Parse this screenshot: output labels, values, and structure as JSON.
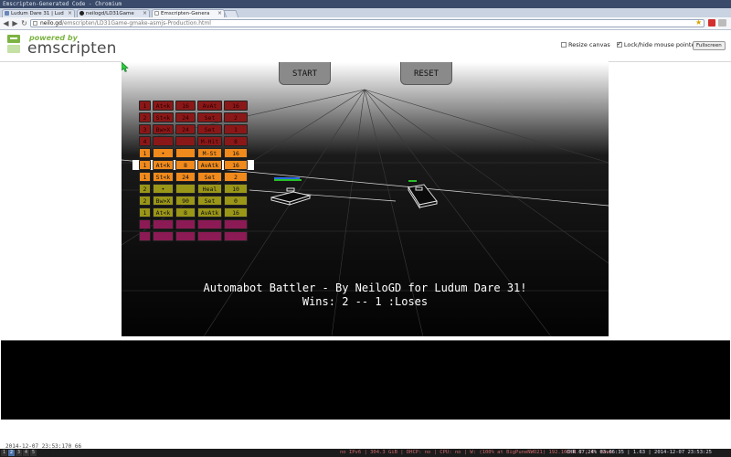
{
  "window": {
    "title": "Emscripten-Generated Code - Chromium"
  },
  "tabs": [
    {
      "label": "Ludum Dare 31 | Lud",
      "active": false
    },
    {
      "label": "neilogd/LD31Game",
      "active": false
    },
    {
      "label": "Emscripten-Genera",
      "active": true
    }
  ],
  "address": {
    "host": "neilo.gd",
    "path": "/emscripten/LD31Game-gmake-asmjs-Production.html"
  },
  "header": {
    "powered_by": "powered by",
    "brand": "emscripten",
    "resize_canvas_label": "Resize canvas",
    "resize_canvas_checked": false,
    "lock_pointer_label": "Lock/hide mouse pointer",
    "lock_pointer_checked": true,
    "fullscreen_label": "Fullscreen"
  },
  "game": {
    "start_label": "START",
    "reset_label": "RESET",
    "title_line": "Automabot Battler - By NeiloGD for Ludum Dare 31!",
    "score_line": "Wins: 2 -- 1 :Loses",
    "colors": {
      "dark_red": "#8b1818",
      "orange": "#f08a1c",
      "olive": "#9a9618",
      "magenta": "#8c1a55",
      "player_hp": "#2a6ae0",
      "green_hp": "#28c028"
    },
    "program_rows": [
      {
        "color": "dark_red",
        "cells": [
          "1",
          "At<k",
          "16",
          "AvAt",
          "16"
        ]
      },
      {
        "color": "dark_red",
        "cells": [
          "2",
          "St<k",
          "24",
          "Set",
          "2"
        ]
      },
      {
        "color": "dark_red",
        "cells": [
          "3",
          "Bw>X",
          "24",
          "Set",
          "1"
        ]
      },
      {
        "color": "dark_red",
        "cells": [
          "4",
          "",
          "",
          "M-Hit",
          "8"
        ]
      },
      {
        "color": "orange",
        "cells": [
          "1",
          "•",
          "",
          "M-St",
          "16"
        ]
      },
      {
        "color": "orange",
        "cells": [
          "1",
          "At<k",
          "8",
          "AvAtk",
          "16"
        ],
        "selected": true
      },
      {
        "color": "orange",
        "cells": [
          "1",
          "St<k",
          "24",
          "Set",
          "2"
        ]
      },
      {
        "color": "olive",
        "cells": [
          "2",
          "•",
          "",
          "Heal",
          "10"
        ]
      },
      {
        "color": "olive",
        "cells": [
          "2",
          "Bw>X",
          "90",
          "Set",
          "0"
        ]
      },
      {
        "color": "olive",
        "cells": [
          "1",
          "At<k",
          "8",
          "AvAtk",
          "16"
        ]
      },
      {
        "color": "magenta",
        "cells": [
          "",
          "",
          "",
          "",
          ""
        ]
      },
      {
        "color": "magenta",
        "cells": [
          "",
          "",
          "",
          "",
          ""
        ]
      }
    ]
  },
  "output": {
    "last_line": "2014-12-07 23:53:170 66"
  },
  "statusbar": {
    "workspaces": [
      "1",
      "2",
      "3",
      "4",
      "5"
    ],
    "active_workspace": 2,
    "left_info": "no IPv6 | 304.3 GiB | DHCP: no | CPU: no | W: (100% at BigPuneNWO21) 192.168.0.7 | E: down",
    "right_info": "CHR 67.24% 03:06:35 | 1.63 | 2014-12-07 23:53:25"
  }
}
